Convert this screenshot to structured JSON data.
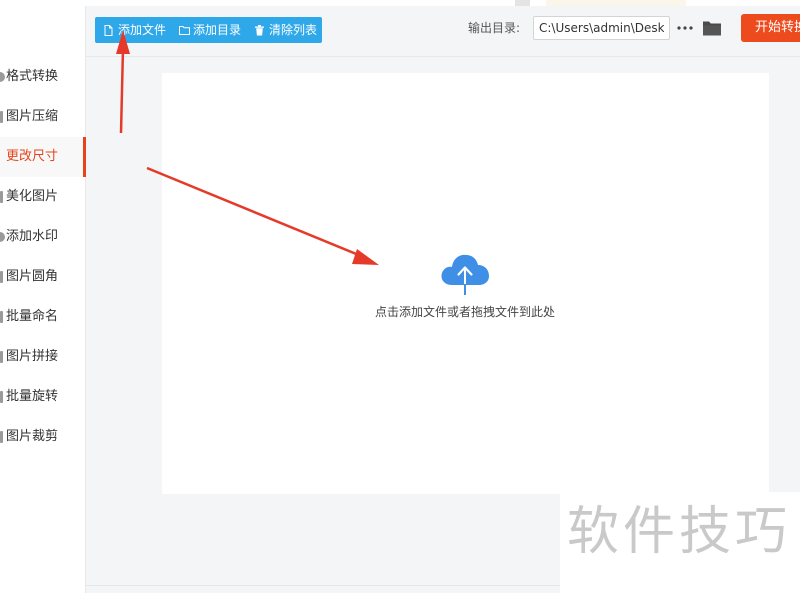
{
  "sidebar": {
    "items": [
      {
        "label": "格式转换",
        "icon": "circle-bullet-icon"
      },
      {
        "label": "图片压缩",
        "icon": "bar-bullet-icon"
      },
      {
        "label": "更改尺寸",
        "icon": "none",
        "active": true
      },
      {
        "label": "美化图片",
        "icon": "bar-bullet-icon"
      },
      {
        "label": "添加水印",
        "icon": "circle-bullet-icon"
      },
      {
        "label": "图片圆角",
        "icon": "bar-bullet-icon"
      },
      {
        "label": "批量命名",
        "icon": "bar-bullet-icon"
      },
      {
        "label": "图片拼接",
        "icon": "bar-bullet-icon"
      },
      {
        "label": "批量旋转",
        "icon": "bar-bullet-icon"
      },
      {
        "label": "图片裁剪",
        "icon": "bar-bullet-icon"
      }
    ],
    "active_color": "#e5441b"
  },
  "toolbar": {
    "add_file_label": "添加文件",
    "add_folder_label": "添加目录",
    "clear_list_label": "清除列表",
    "bg_color": "#2fa8ea"
  },
  "output": {
    "label": "输出目录:",
    "path_value": "C:\\Users\\admin\\Deskto",
    "more_icon": "ellipsis-icon",
    "browse_icon": "folder-icon"
  },
  "start_button": {
    "label": "开始转换",
    "color": "#ed4a1d"
  },
  "drop_zone": {
    "icon": "cloud-upload-icon",
    "hint": "点击添加文件或者拖拽文件到此处"
  },
  "watermark": {
    "text": "软件技巧"
  },
  "annotations": {
    "arrow_color": "#e53a2a"
  }
}
